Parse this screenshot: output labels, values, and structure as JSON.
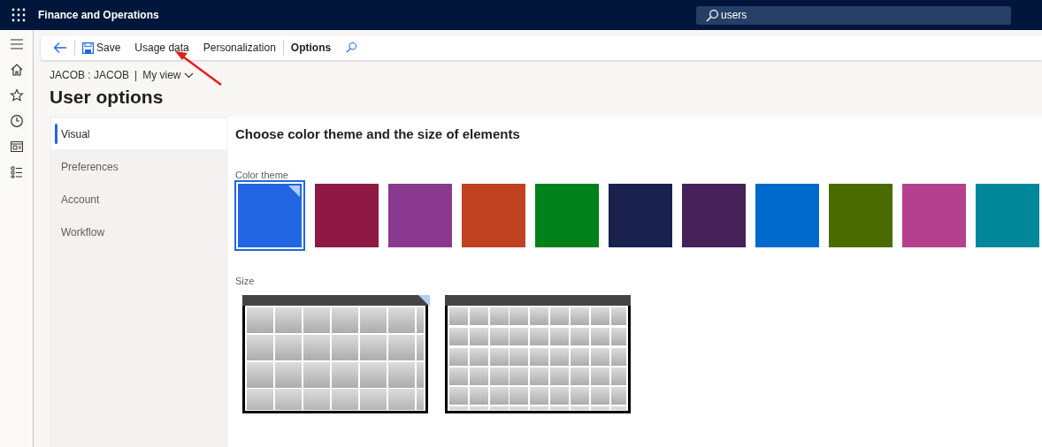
{
  "app_title": "Finance and Operations",
  "search": {
    "value": "users"
  },
  "actions": [
    {
      "label": "Save",
      "kind": "save"
    },
    {
      "label": "Usage data",
      "kind": "plain"
    },
    {
      "label": "Personalization",
      "kind": "plain"
    },
    {
      "label": "Options",
      "kind": "bold"
    }
  ],
  "breadcrumb": {
    "user": "JACOB : JACOB",
    "separator": "|",
    "view": "My view"
  },
  "page_title": "User options",
  "tabs": [
    {
      "label": "Visual",
      "selected": true
    },
    {
      "label": "Preferences",
      "selected": false
    },
    {
      "label": "Account",
      "selected": false
    },
    {
      "label": "Workflow",
      "selected": false
    }
  ],
  "section_title": "Choose color theme and the size of elements",
  "color_theme": {
    "label": "Color theme",
    "swatches": [
      {
        "color": "#2266e3",
        "selected": true
      },
      {
        "color": "#8e1944",
        "selected": false
      },
      {
        "color": "#8a3a8e",
        "selected": false
      },
      {
        "color": "#bf4222",
        "selected": false
      },
      {
        "color": "#008119",
        "selected": false
      },
      {
        "color": "#19224f",
        "selected": false
      },
      {
        "color": "#46215a",
        "selected": false
      },
      {
        "color": "#006acc",
        "selected": false
      },
      {
        "color": "#4a6b00",
        "selected": false
      },
      {
        "color": "#b4418e",
        "selected": false
      },
      {
        "color": "#00889a",
        "selected": false
      }
    ]
  },
  "size": {
    "label": "Size",
    "options": [
      {
        "kind": "large",
        "selected": true
      },
      {
        "kind": "compact",
        "selected": false
      }
    ]
  }
}
